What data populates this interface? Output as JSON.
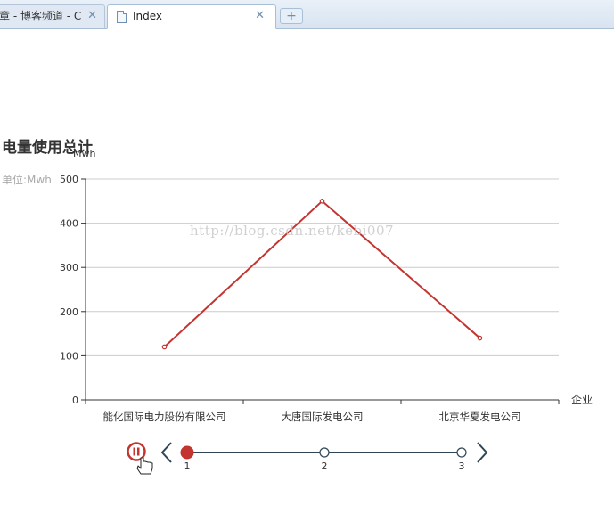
{
  "browser": {
    "tabs": [
      {
        "label": "章 - 博客频道 - C",
        "close": "✕",
        "active": false
      },
      {
        "label": "Index",
        "close": "✕",
        "active": true
      }
    ],
    "new_tab": "+"
  },
  "chart_data": {
    "type": "line",
    "title": "电量使用总计",
    "subtitle": "单位:Mwh",
    "ylabel": "Mwh",
    "xlabel": "企业",
    "categories": [
      "能化国际电力股份有限公司",
      "大唐国际发电公司",
      "北京华夏发电公司"
    ],
    "values": [
      120,
      450,
      140
    ],
    "ylim": [
      0,
      500
    ],
    "yticks": [
      0,
      100,
      200,
      300,
      400,
      500
    ],
    "grid": true,
    "color": "#c23531"
  },
  "watermark": "http://blog.csdn.net/kebi007",
  "timeline": {
    "items": [
      "1",
      "2",
      "3"
    ],
    "current_index": 0,
    "play_state": "playing",
    "accent": "#c23531",
    "line_color": "#304654"
  }
}
